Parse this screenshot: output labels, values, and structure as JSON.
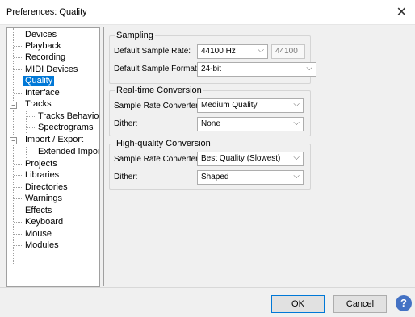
{
  "window": {
    "title": "Preferences: Quality",
    "close_glyph": "✕"
  },
  "tree": {
    "items": [
      {
        "label": "Devices"
      },
      {
        "label": "Playback"
      },
      {
        "label": "Recording"
      },
      {
        "label": "MIDI Devices"
      },
      {
        "label": "Quality",
        "selected": true
      },
      {
        "label": "Interface"
      },
      {
        "label": "Tracks",
        "expander": "−"
      },
      {
        "label": "Tracks Behaviors"
      },
      {
        "label": "Spectrograms"
      },
      {
        "label": "Import / Export",
        "expander": "−"
      },
      {
        "label": "Extended Import"
      },
      {
        "label": "Projects"
      },
      {
        "label": "Libraries"
      },
      {
        "label": "Directories"
      },
      {
        "label": "Warnings"
      },
      {
        "label": "Effects"
      },
      {
        "label": "Keyboard"
      },
      {
        "label": "Mouse"
      },
      {
        "label": "Modules"
      }
    ]
  },
  "sampling": {
    "title": "Sampling",
    "rate_label": "Default Sample Rate:",
    "rate_value": "44100 Hz",
    "rate_text": "44100",
    "format_label": "Default Sample Format:",
    "format_value": "24-bit"
  },
  "realtime": {
    "title": "Real-time Conversion",
    "converter_label": "Sample Rate Converter:",
    "converter_value": "Medium Quality",
    "dither_label": "Dither:",
    "dither_value": "None"
  },
  "highquality": {
    "title": "High-quality Conversion",
    "converter_label": "Sample Rate Converter:",
    "converter_value": "Best Quality (Slowest)",
    "dither_label": "Dither:",
    "dither_value": "Shaped"
  },
  "buttons": {
    "ok": "OK",
    "cancel": "Cancel",
    "help": "?"
  },
  "combo_arrow": "⌵"
}
